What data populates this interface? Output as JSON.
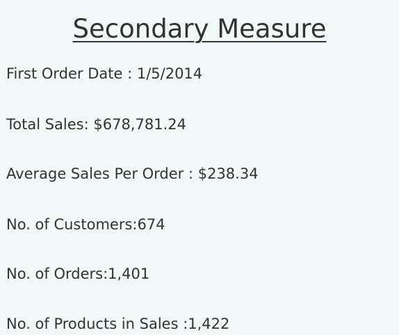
{
  "title": "Secondary Measure",
  "metrics": [
    {
      "text": "First Order Date : 1/5/2014"
    },
    {
      "text": "Total Sales: $678,781.24"
    },
    {
      "text": "Average Sales Per Order : $238.34"
    },
    {
      "text": "No. of Customers:674"
    },
    {
      "text": "No. of Orders:1,401"
    },
    {
      "text": "No. of Products in Sales :1,422"
    }
  ],
  "colors": {
    "background": "#f0f9f7",
    "text": "#333333"
  }
}
